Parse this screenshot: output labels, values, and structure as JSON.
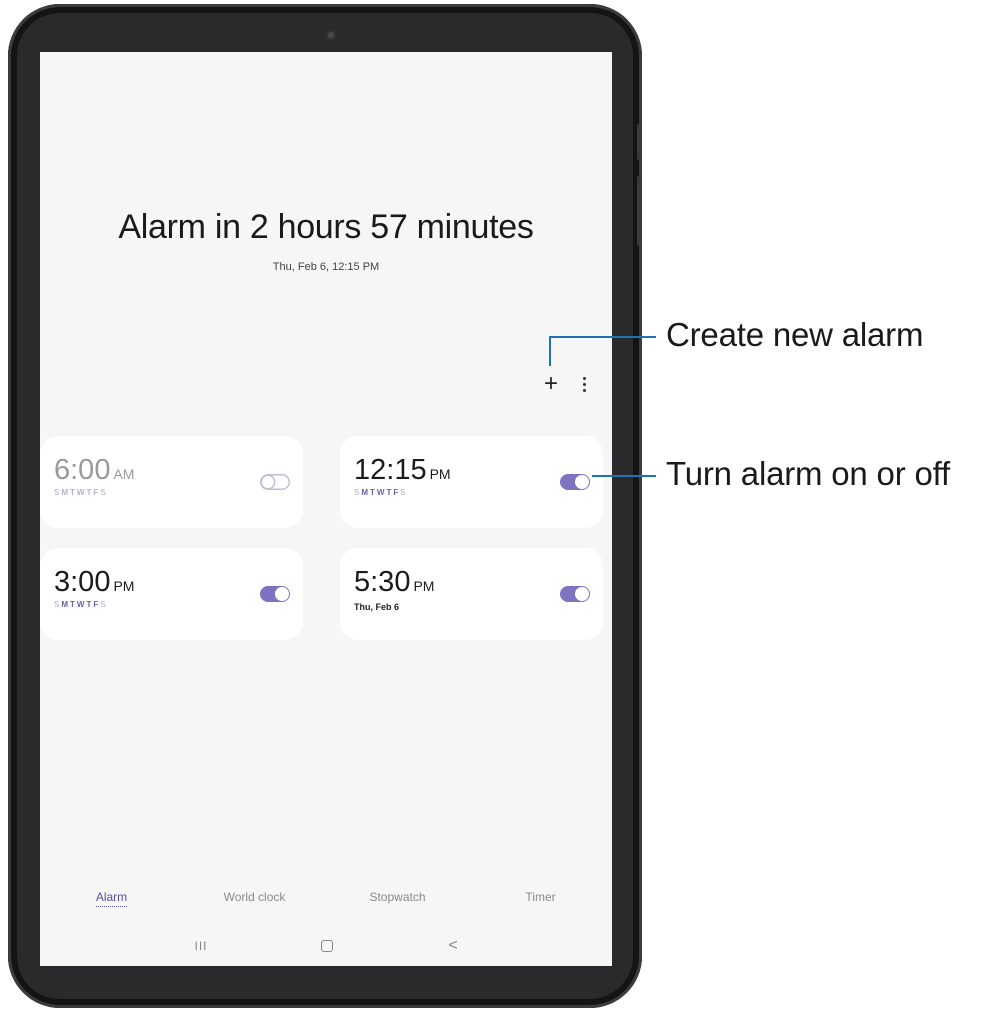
{
  "header": {
    "title": "Alarm in 2 hours 57 minutes",
    "subtitle": "Thu, Feb 6, 12:15 PM"
  },
  "toolbar": {
    "add_icon": "+",
    "more_icon": "more-vertical-icon"
  },
  "alarms": [
    {
      "time": "6:00",
      "ampm": "AM",
      "days": "MTWTF",
      "weekend_start": "S",
      "weekend_end": "S",
      "enabled": false
    },
    {
      "time": "12:15",
      "ampm": "PM",
      "days": "MTWTF",
      "weekend_start": "S",
      "weekend_end": "S",
      "enabled": true
    },
    {
      "time": "3:00",
      "ampm": "PM",
      "days": "MTWTF",
      "weekend_start": "S",
      "weekend_end": "S",
      "enabled": true
    },
    {
      "time": "5:30",
      "ampm": "PM",
      "date": "Thu, Feb 6",
      "enabled": true
    }
  ],
  "tabs": [
    "Alarm",
    "World clock",
    "Stopwatch",
    "Timer"
  ],
  "active_tab": "Alarm",
  "navbar": {
    "recent": "III",
    "back": "<"
  },
  "callouts": {
    "create": "Create new alarm",
    "toggle": "Turn alarm on or off"
  },
  "colors": {
    "accent": "#7d73c0",
    "callout_line": "#1d72b8"
  }
}
